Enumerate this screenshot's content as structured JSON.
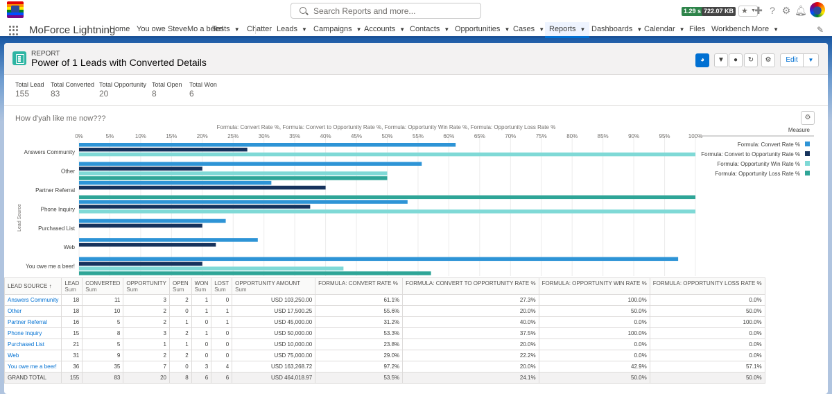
{
  "header": {
    "search_placeholder": "Search Reports and more...",
    "badge_time": "1.29 s",
    "badge_size": "722.07 KB"
  },
  "nav": {
    "app_name": "MoForce Lightning",
    "items": [
      {
        "label": "Home",
        "chevron": false
      },
      {
        "label": "You owe SteveMo a beer!",
        "chevron": false
      },
      {
        "label": "Tests",
        "chevron": true
      },
      {
        "label": "Chatter",
        "chevron": false
      },
      {
        "label": "Leads",
        "chevron": true
      },
      {
        "label": "Campaigns",
        "chevron": true
      },
      {
        "label": "Accounts",
        "chevron": true
      },
      {
        "label": "Contacts",
        "chevron": true
      },
      {
        "label": "Opportunities",
        "chevron": true
      },
      {
        "label": "Cases",
        "chevron": true
      },
      {
        "label": "Reports",
        "chevron": true,
        "active": true
      },
      {
        "label": "Dashboards",
        "chevron": true
      },
      {
        "label": "Calendar",
        "chevron": true
      },
      {
        "label": "Files",
        "chevron": false
      },
      {
        "label": "Workbench",
        "chevron": false
      },
      {
        "label": "More",
        "chevron": true
      }
    ]
  },
  "report": {
    "eyebrow": "REPORT",
    "title": "Power of 1 Leads with Converted Details",
    "edit_label": "Edit",
    "summary": [
      {
        "label": "Total Lead",
        "value": "155"
      },
      {
        "label": "Total Converted",
        "value": "83"
      },
      {
        "label": "Total Opportunity",
        "value": "20"
      },
      {
        "label": "Total Open",
        "value": "8"
      },
      {
        "label": "Total Won",
        "value": "6"
      }
    ],
    "chart_heading": "How d'yah like me now???"
  },
  "chart_data": {
    "type": "bar",
    "orientation": "horizontal",
    "title": "Formula: Convert Rate %, Formula: Convert to Opportunity Rate %, Formula: Opportunity Win Rate %, Formula: Opportunity Loss Rate %",
    "ylabel": "Lead Source",
    "xlim": [
      0,
      100
    ],
    "x_ticks": [
      "0%",
      "5%",
      "10%",
      "15%",
      "20%",
      "25%",
      "30%",
      "35%",
      "40%",
      "45%",
      "50%",
      "55%",
      "60%",
      "65%",
      "70%",
      "75%",
      "80%",
      "85%",
      "90%",
      "95%",
      "100%"
    ],
    "legend_title": "Measure",
    "legend_position": "right",
    "categories": [
      "Answers Community",
      "Other",
      "Partner Referral",
      "Phone Inquiry",
      "Purchased List",
      "Web",
      "You owe me a beer!"
    ],
    "series": [
      {
        "name": "Formula: Convert Rate %",
        "color": "#2e94d6",
        "values": [
          61.1,
          55.6,
          31.2,
          53.3,
          23.8,
          29.0,
          97.2
        ]
      },
      {
        "name": "Formula: Convert to Opportunity Rate %",
        "color": "#16325c",
        "values": [
          27.3,
          20.0,
          40.0,
          37.5,
          20.0,
          22.2,
          20.0
        ]
      },
      {
        "name": "Formula: Opportunity Win Rate %",
        "color": "#7fd9d6",
        "values": [
          100.0,
          50.0,
          0.0,
          100.0,
          0.0,
          0.0,
          42.9
        ]
      },
      {
        "name": "Formula: Opportunity Loss Rate %",
        "color": "#2ea597",
        "values": [
          0.0,
          50.0,
          100.0,
          0.0,
          0.0,
          0.0,
          57.1
        ]
      }
    ]
  },
  "table": {
    "columns": [
      {
        "label": "LEAD SOURCE",
        "sub": "",
        "sort": "↑"
      },
      {
        "label": "LEAD",
        "sub": "Sum"
      },
      {
        "label": "CONVERTED",
        "sub": "Sum"
      },
      {
        "label": "OPPORTUNITY",
        "sub": "Sum"
      },
      {
        "label": "OPEN",
        "sub": "Sum"
      },
      {
        "label": "WON",
        "sub": "Sum"
      },
      {
        "label": "LOST",
        "sub": "Sum"
      },
      {
        "label": "OPPORTUNITY AMOUNT",
        "sub": "Sum"
      },
      {
        "label": "FORMULA: CONVERT RATE %",
        "sub": ""
      },
      {
        "label": "FORMULA: CONVERT TO OPPORTUNITY RATE %",
        "sub": ""
      },
      {
        "label": "FORMULA: OPPORTUNITY WIN RATE %",
        "sub": ""
      },
      {
        "label": "FORMULA: OPPORTUNITY LOSS RATE %",
        "sub": ""
      }
    ],
    "rows": [
      [
        "Answers Community",
        "18",
        "11",
        "3",
        "2",
        "1",
        "0",
        "USD 103,250.00",
        "61.1%",
        "27.3%",
        "100.0%",
        "0.0%"
      ],
      [
        "Other",
        "18",
        "10",
        "2",
        "0",
        "1",
        "1",
        "USD 17,500.25",
        "55.6%",
        "20.0%",
        "50.0%",
        "50.0%"
      ],
      [
        "Partner Referral",
        "16",
        "5",
        "2",
        "1",
        "0",
        "1",
        "USD 45,000.00",
        "31.2%",
        "40.0%",
        "0.0%",
        "100.0%"
      ],
      [
        "Phone Inquiry",
        "15",
        "8",
        "3",
        "2",
        "1",
        "0",
        "USD 50,000.00",
        "53.3%",
        "37.5%",
        "100.0%",
        "0.0%"
      ],
      [
        "Purchased List",
        "21",
        "5",
        "1",
        "1",
        "0",
        "0",
        "USD 10,000.00",
        "23.8%",
        "20.0%",
        "0.0%",
        "0.0%"
      ],
      [
        "Web",
        "31",
        "9",
        "2",
        "2",
        "0",
        "0",
        "USD 75,000.00",
        "29.0%",
        "22.2%",
        "0.0%",
        "0.0%"
      ],
      [
        "You owe me a beer!",
        "36",
        "35",
        "7",
        "0",
        "3",
        "4",
        "USD 163,268.72",
        "97.2%",
        "20.0%",
        "42.9%",
        "57.1%"
      ]
    ],
    "total": [
      "GRAND TOTAL",
      "155",
      "83",
      "20",
      "8",
      "6",
      "6",
      "USD 464,018.97",
      "53.5%",
      "24.1%",
      "50.0%",
      "50.0%"
    ]
  }
}
